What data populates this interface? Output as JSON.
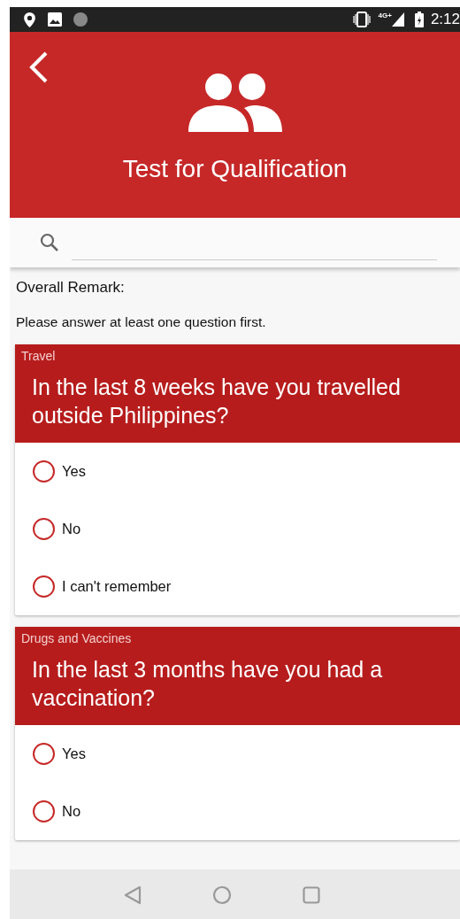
{
  "status_bar": {
    "time": "2:12",
    "network": "4G+"
  },
  "header": {
    "title": "Test for Qualification"
  },
  "overall_remark": "Overall Remark:",
  "notice": "Please answer at least one question first.",
  "questions": [
    {
      "category": "Travel",
      "text": "In the last 8 weeks have you travelled outside Philippines?",
      "options": [
        {
          "label": "Yes",
          "selected": false
        },
        {
          "label": "No",
          "selected": false
        },
        {
          "label": "I can't remember",
          "selected": false
        }
      ]
    },
    {
      "category": "Drugs and Vaccines",
      "text": "In the last 3 months have you had a vaccination?",
      "options": [
        {
          "label": "Yes",
          "selected": false
        },
        {
          "label": "No",
          "selected": false
        }
      ]
    }
  ]
}
